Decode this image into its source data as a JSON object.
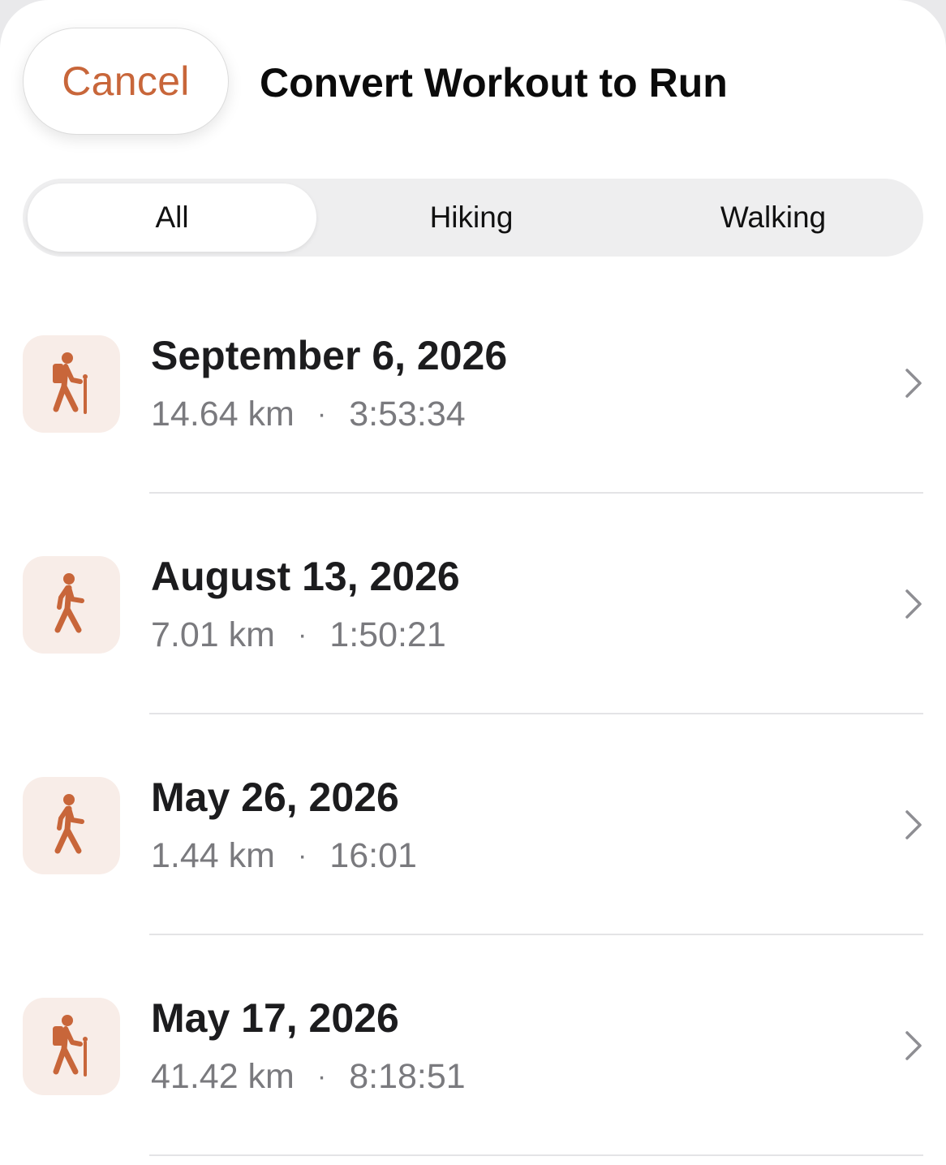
{
  "header": {
    "cancel_label": "Cancel",
    "title": "Convert Workout to Run"
  },
  "filters": {
    "selected": "All",
    "tabs": [
      {
        "label": "All"
      },
      {
        "label": "Hiking"
      },
      {
        "label": "Walking"
      }
    ]
  },
  "workouts": [
    {
      "date": "September 6, 2026",
      "distance": "14.64 km",
      "separator": "·",
      "duration": "3:53:34",
      "icon": "hiking-icon"
    },
    {
      "date": "August 13, 2026",
      "distance": "7.01 km",
      "separator": "·",
      "duration": "1:50:21",
      "icon": "walking-icon"
    },
    {
      "date": "May 26, 2026",
      "distance": "1.44 km",
      "separator": "·",
      "duration": "16:01",
      "icon": "walking-icon"
    },
    {
      "date": "May 17, 2026",
      "distance": "41.42 km",
      "separator": "·",
      "duration": "8:18:51",
      "icon": "hiking-icon"
    }
  ],
  "colors": {
    "accent": "#c8663a",
    "icon_tile_bg": "#f8ede8",
    "secondary_text": "#7a7a7e",
    "segment_bg": "#eeeeef"
  }
}
